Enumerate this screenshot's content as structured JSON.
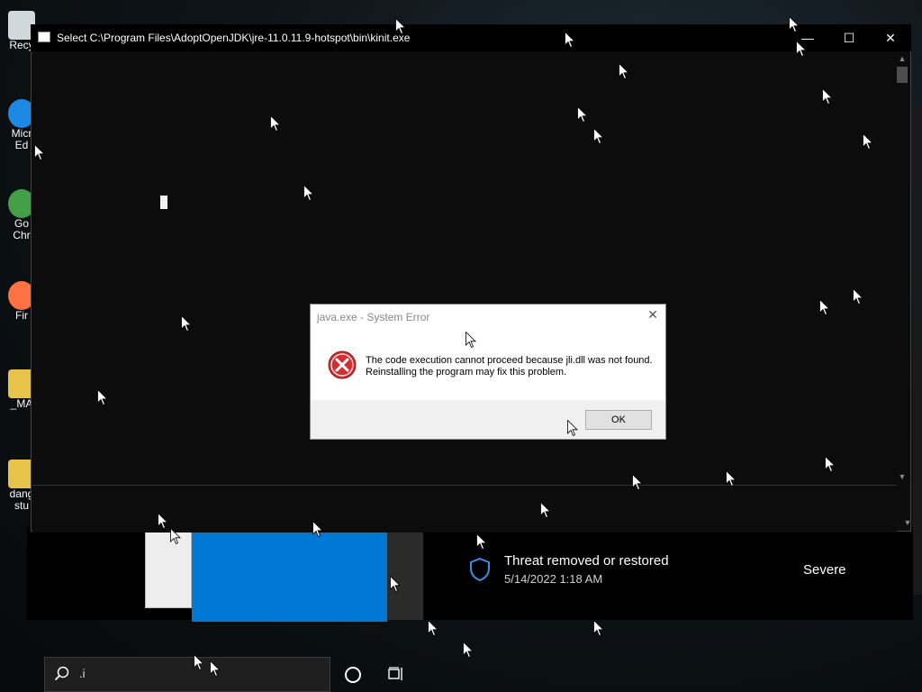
{
  "desktop": {
    "icons": [
      {
        "label": "Recy",
        "color": "#cfd8dc"
      },
      {
        "label": "Micr\nEd",
        "color": "#1e88e5"
      },
      {
        "label": "Go\nChr",
        "color": "#43a047"
      },
      {
        "label": "Fir",
        "color": "#ff7043"
      },
      {
        "label": "_MA",
        "color": "#e8c34a"
      },
      {
        "label": "dang\nstu",
        "color": "#e8c34a"
      }
    ]
  },
  "console": {
    "title": "Select C:\\Program Files\\AdoptOpenJDK\\jre-11.0.11.9-hotspot\\bin\\kinit.exe",
    "minimize_glyph": "—",
    "maximize_glyph": "☐",
    "close_glyph": "✕"
  },
  "dialog": {
    "title": "java.exe - System Error",
    "message": "The code execution cannot proceed because jli.dll was not found. Reinstalling the program may fix this problem.",
    "ok_label": "OK",
    "close_glyph": "✕",
    "icon": "error-icon"
  },
  "security": {
    "threat_title": "Threat removed or restored",
    "threat_date": "5/14/2022 1:18 AM",
    "severity": "Severe",
    "icon": "shield-icon"
  },
  "taskbar": {
    "search_text": ".i",
    "icons": [
      "search-icon",
      "cortana-icon",
      "task-view-icon"
    ]
  },
  "colors": {
    "accent_blue": "#0078d4",
    "error_red": "#d32f2f"
  }
}
